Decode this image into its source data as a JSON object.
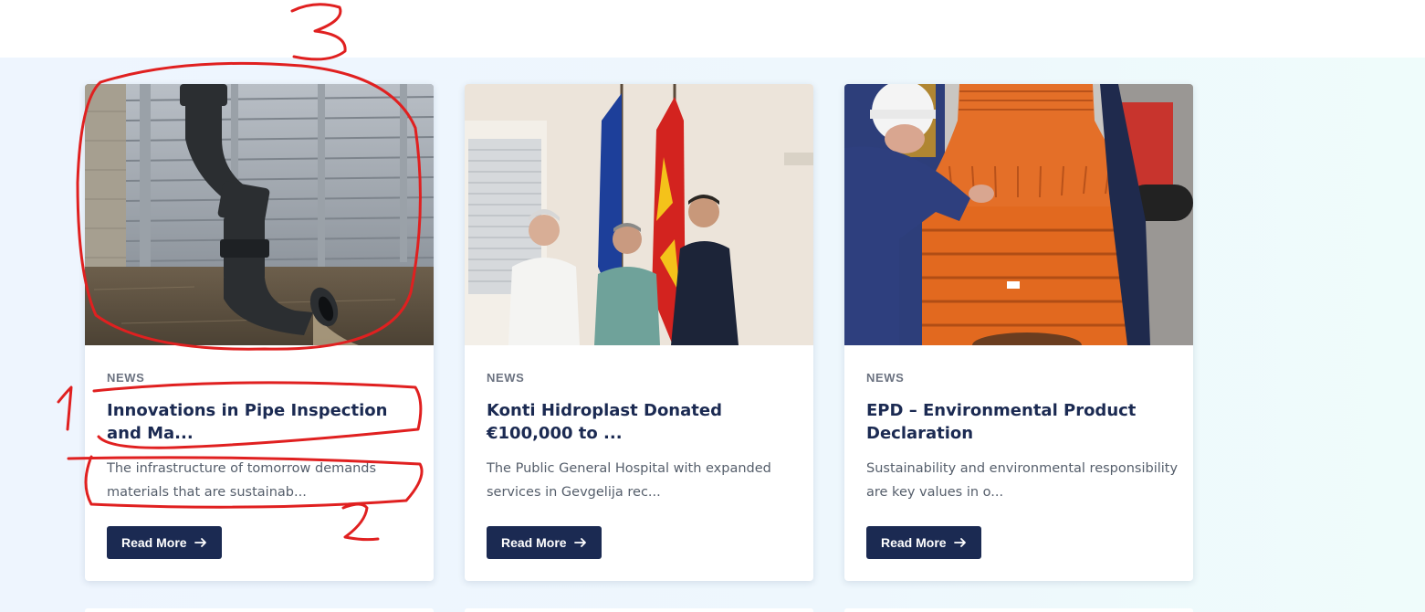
{
  "cards": [
    {
      "category": "NEWS",
      "title": "Innovations in Pipe Inspection and Ma...",
      "excerpt": "The infrastructure of tomorrow demands materials that are sustainab...",
      "button_label": "Read More",
      "image": "black drainage pipe discharging water beside a metal flood barrier"
    },
    {
      "category": "NEWS",
      "title": "Konti Hidroplast Donated €100,000 to ...",
      "excerpt": "The Public General Hospital with expanded services in Gevgelija rec...",
      "button_label": "Read More",
      "image": "three men posing in front of EU and North Macedonia flags"
    },
    {
      "category": "NEWS",
      "title": "EPD – Environmental Product Declaration",
      "excerpt": "Sustainability and environmental responsibility are key values in o...",
      "button_label": "Read More",
      "image": "worker in hard hat handling a large orange plastic manhole"
    }
  ],
  "annotations": {
    "labels": [
      "1",
      "2",
      "3"
    ],
    "color": "#e02020"
  },
  "colors": {
    "button_bg": "#1b2a52",
    "title": "#1b2a52",
    "section_bg": "#eef6fd"
  },
  "icons": {
    "button_icon": "arrow-right-icon"
  }
}
